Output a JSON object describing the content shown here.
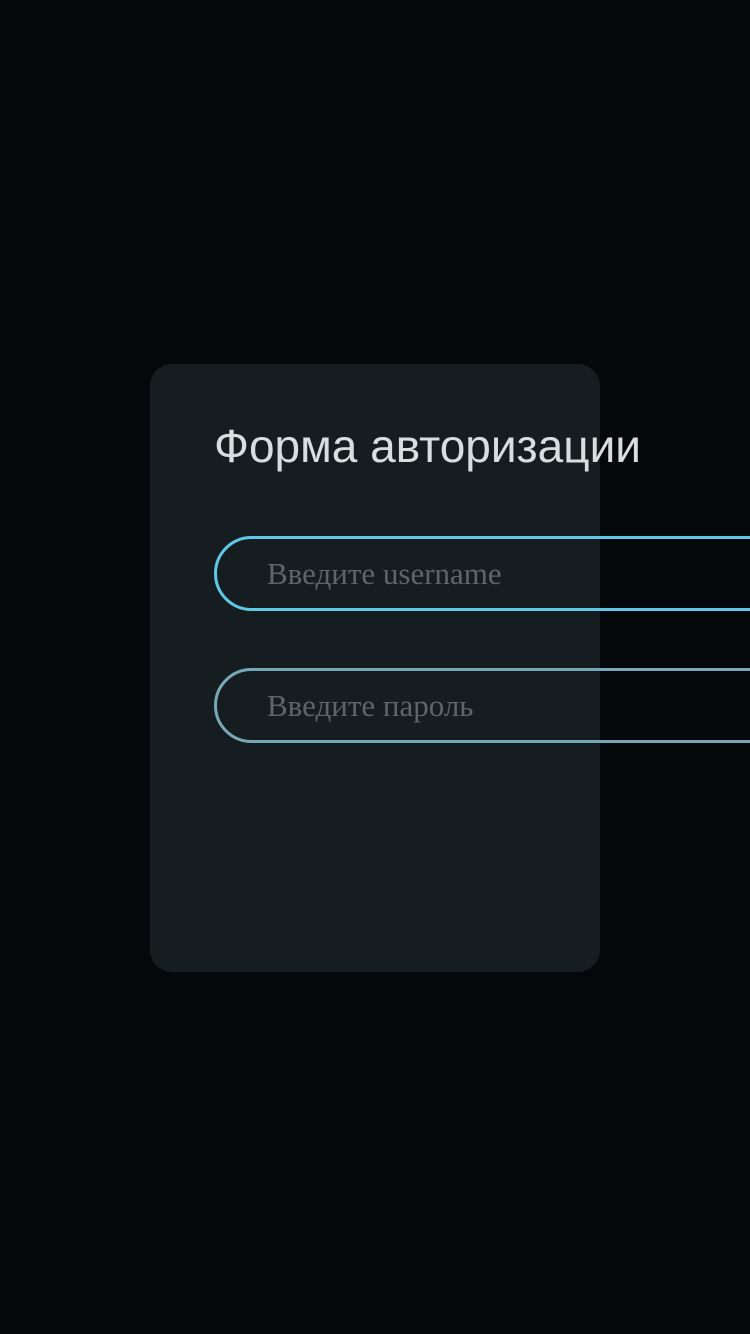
{
  "form": {
    "title": "Форма авторизации",
    "username": {
      "value": "",
      "placeholder": "Введите username"
    },
    "password": {
      "value": "",
      "placeholder": "Введите пароль"
    }
  },
  "colors": {
    "background": "#05080a",
    "card": "#161d21",
    "title_text": "#d8dde0",
    "placeholder_text": "#5f6468",
    "username_border": "#5fc8e6",
    "password_border": "#78a8b8"
  }
}
